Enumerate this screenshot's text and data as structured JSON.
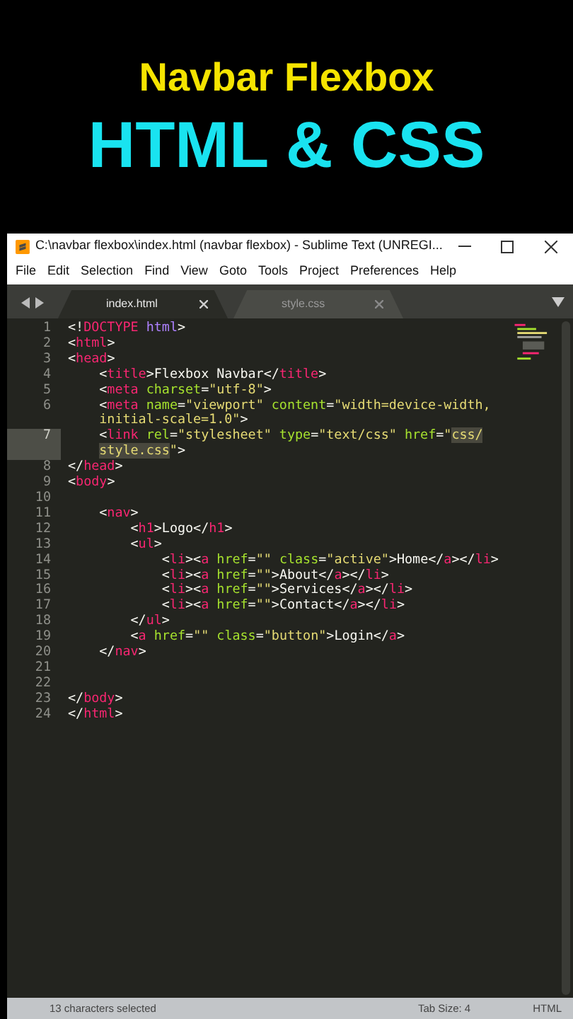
{
  "banner": {
    "title": "Navbar Flexbox",
    "subtitle": "HTML & CSS"
  },
  "window": {
    "title": "C:\\navbar flexbox\\index.html (navbar flexbox) - Sublime Text (UNREGI..."
  },
  "menu": [
    "File",
    "Edit",
    "Selection",
    "Find",
    "View",
    "Goto",
    "Tools",
    "Project",
    "Preferences",
    "Help"
  ],
  "tabs": [
    {
      "label": "index.html",
      "selected": true
    },
    {
      "label": "style.css",
      "selected": false
    }
  ],
  "code": [
    {
      "number": "1",
      "current": false,
      "segments": [
        {
          "kind": "punct",
          "text": "<!"
        },
        {
          "kind": "tag",
          "text": "DOCTYPE"
        },
        {
          "kind": "keyword",
          "text": " html"
        },
        {
          "kind": "punct",
          "text": ">"
        }
      ]
    },
    {
      "number": "2",
      "current": false,
      "segments": [
        {
          "kind": "punct",
          "text": "<"
        },
        {
          "kind": "tag",
          "text": "html"
        },
        {
          "kind": "punct",
          "text": ">"
        }
      ]
    },
    {
      "number": "3",
      "current": false,
      "segments": [
        {
          "kind": "punct",
          "text": "<"
        },
        {
          "kind": "tag",
          "text": "head"
        },
        {
          "kind": "punct",
          "text": ">"
        }
      ]
    },
    {
      "number": "4",
      "current": false,
      "segments": [
        {
          "kind": "punct",
          "text": "    <"
        },
        {
          "kind": "tag",
          "text": "title"
        },
        {
          "kind": "punct",
          "text": ">Flexbox Navbar</"
        },
        {
          "kind": "tag",
          "text": "title"
        },
        {
          "kind": "punct",
          "text": ">"
        }
      ]
    },
    {
      "number": "5",
      "current": false,
      "segments": [
        {
          "kind": "punct",
          "text": "    <"
        },
        {
          "kind": "tag",
          "text": "meta"
        },
        {
          "kind": "attr",
          "text": " charset"
        },
        {
          "kind": "punct",
          "text": "="
        },
        {
          "kind": "string",
          "text": "\"utf-8\""
        },
        {
          "kind": "punct",
          "text": ">"
        }
      ]
    },
    {
      "number": "6",
      "current": false,
      "segments": [
        {
          "kind": "punct",
          "text": "    <"
        },
        {
          "kind": "tag",
          "text": "meta"
        },
        {
          "kind": "attr",
          "text": " name"
        },
        {
          "kind": "punct",
          "text": "="
        },
        {
          "kind": "string",
          "text": "\"viewport\""
        },
        {
          "kind": "attr",
          "text": " content"
        },
        {
          "kind": "punct",
          "text": "="
        },
        {
          "kind": "string",
          "text": "\"width=device-width,"
        }
      ]
    },
    {
      "current": false,
      "segments": [
        {
          "kind": "string",
          "text": "initial-scale=1.0\""
        },
        {
          "kind": "punct",
          "text": ">"
        }
      ]
    },
    {
      "number": "7",
      "current": true,
      "segments": [
        {
          "kind": "punct",
          "text": "    <"
        },
        {
          "kind": "tag",
          "text": "link"
        },
        {
          "kind": "attr",
          "text": " rel"
        },
        {
          "kind": "punct",
          "text": "="
        },
        {
          "kind": "string",
          "text": "\"stylesheet\""
        },
        {
          "kind": "attr",
          "text": " type"
        },
        {
          "kind": "punct",
          "text": "="
        },
        {
          "kind": "string",
          "text": "\"text/css\""
        },
        {
          "kind": "attr",
          "text": " href"
        },
        {
          "kind": "punct",
          "text": "="
        },
        {
          "kind": "string",
          "text": "\""
        },
        {
          "kind": "selection",
          "text": "css/"
        }
      ]
    },
    {
      "current": true,
      "segments": [
        {
          "kind": "selection",
          "text": "style.css"
        },
        {
          "kind": "string",
          "text": "\""
        },
        {
          "kind": "punct",
          "text": ">"
        }
      ]
    },
    {
      "number": "8",
      "current": false,
      "segments": [
        {
          "kind": "punct",
          "text": "</"
        },
        {
          "kind": "tag",
          "text": "head"
        },
        {
          "kind": "punct",
          "text": ">"
        }
      ]
    },
    {
      "number": "9",
      "current": false,
      "segments": [
        {
          "kind": "punct",
          "text": "<"
        },
        {
          "kind": "tag",
          "text": "body"
        },
        {
          "kind": "punct",
          "text": ">"
        }
      ]
    },
    {
      "number": "10",
      "current": false
    },
    {
      "number": "11",
      "current": false,
      "segments": [
        {
          "kind": "punct",
          "text": "    <"
        },
        {
          "kind": "tag",
          "text": "nav"
        },
        {
          "kind": "punct",
          "text": ">"
        }
      ]
    },
    {
      "number": "12",
      "current": false,
      "segments": [
        {
          "kind": "punct",
          "text": "        <"
        },
        {
          "kind": "tag",
          "text": "h1"
        },
        {
          "kind": "punct",
          "text": ">Logo</"
        },
        {
          "kind": "tag",
          "text": "h1"
        },
        {
          "kind": "punct",
          "text": ">"
        }
      ]
    },
    {
      "number": "13",
      "current": false,
      "segments": [
        {
          "kind": "punct",
          "text": "        <"
        },
        {
          "kind": "tag",
          "text": "ul"
        },
        {
          "kind": "punct",
          "text": ">"
        }
      ]
    },
    {
      "number": "14",
      "current": false,
      "segments": [
        {
          "kind": "punct",
          "text": "            <"
        },
        {
          "kind": "tag",
          "text": "li"
        },
        {
          "kind": "punct",
          "text": "><"
        },
        {
          "kind": "tag",
          "text": "a"
        },
        {
          "kind": "attr",
          "text": " href"
        },
        {
          "kind": "punct",
          "text": "="
        },
        {
          "kind": "string",
          "text": "\"\""
        },
        {
          "kind": "attr",
          "text": " class"
        },
        {
          "kind": "punct",
          "text": "="
        },
        {
          "kind": "string",
          "text": "\"active\""
        },
        {
          "kind": "punct",
          "text": ">Home</"
        },
        {
          "kind": "tag",
          "text": "a"
        },
        {
          "kind": "punct",
          "text": "></"
        },
        {
          "kind": "tag",
          "text": "li"
        },
        {
          "kind": "punct",
          "text": ">"
        }
      ]
    },
    {
      "number": "15",
      "current": false,
      "segments": [
        {
          "kind": "punct",
          "text": "            <"
        },
        {
          "kind": "tag",
          "text": "li"
        },
        {
          "kind": "punct",
          "text": "><"
        },
        {
          "kind": "tag",
          "text": "a"
        },
        {
          "kind": "attr",
          "text": " href"
        },
        {
          "kind": "punct",
          "text": "="
        },
        {
          "kind": "string",
          "text": "\"\""
        },
        {
          "kind": "punct",
          "text": ">About</"
        },
        {
          "kind": "tag",
          "text": "a"
        },
        {
          "kind": "punct",
          "text": "></"
        },
        {
          "kind": "tag",
          "text": "li"
        },
        {
          "kind": "punct",
          "text": ">"
        }
      ]
    },
    {
      "number": "16",
      "current": false,
      "segments": [
        {
          "kind": "punct",
          "text": "            <"
        },
        {
          "kind": "tag",
          "text": "li"
        },
        {
          "kind": "punct",
          "text": "><"
        },
        {
          "kind": "tag",
          "text": "a"
        },
        {
          "kind": "attr",
          "text": " href"
        },
        {
          "kind": "punct",
          "text": "="
        },
        {
          "kind": "string",
          "text": "\"\""
        },
        {
          "kind": "punct",
          "text": ">Services</"
        },
        {
          "kind": "tag",
          "text": "a"
        },
        {
          "kind": "punct",
          "text": "></"
        },
        {
          "kind": "tag",
          "text": "li"
        },
        {
          "kind": "punct",
          "text": ">"
        }
      ]
    },
    {
      "number": "17",
      "current": false,
      "segments": [
        {
          "kind": "punct",
          "text": "            <"
        },
        {
          "kind": "tag",
          "text": "li"
        },
        {
          "kind": "punct",
          "text": "><"
        },
        {
          "kind": "tag",
          "text": "a"
        },
        {
          "kind": "attr",
          "text": " href"
        },
        {
          "kind": "punct",
          "text": "="
        },
        {
          "kind": "string",
          "text": "\"\""
        },
        {
          "kind": "punct",
          "text": ">Contact</"
        },
        {
          "kind": "tag",
          "text": "a"
        },
        {
          "kind": "punct",
          "text": "></"
        },
        {
          "kind": "tag",
          "text": "li"
        },
        {
          "kind": "punct",
          "text": ">"
        }
      ]
    },
    {
      "number": "18",
      "current": false,
      "segments": [
        {
          "kind": "punct",
          "text": "        </"
        },
        {
          "kind": "tag",
          "text": "ul"
        },
        {
          "kind": "punct",
          "text": ">"
        }
      ]
    },
    {
      "number": "19",
      "current": false,
      "segments": [
        {
          "kind": "punct",
          "text": "        <"
        },
        {
          "kind": "tag",
          "text": "a"
        },
        {
          "kind": "attr",
          "text": " href"
        },
        {
          "kind": "punct",
          "text": "="
        },
        {
          "kind": "string",
          "text": "\"\""
        },
        {
          "kind": "attr",
          "text": " class"
        },
        {
          "kind": "punct",
          "text": "="
        },
        {
          "kind": "string",
          "text": "\"button\""
        },
        {
          "kind": "punct",
          "text": ">Login</"
        },
        {
          "kind": "tag",
          "text": "a"
        },
        {
          "kind": "punct",
          "text": ">"
        }
      ]
    },
    {
      "number": "20",
      "current": false,
      "segments": [
        {
          "kind": "punct",
          "text": "    </"
        },
        {
          "kind": "tag",
          "text": "nav"
        },
        {
          "kind": "punct",
          "text": ">"
        }
      ]
    },
    {
      "number": "21",
      "current": false
    },
    {
      "number": "22",
      "current": false
    },
    {
      "number": "23",
      "current": false,
      "segments": [
        {
          "kind": "punct",
          "text": "</"
        },
        {
          "kind": "tag",
          "text": "body"
        },
        {
          "kind": "punct",
          "text": ">"
        }
      ]
    },
    {
      "number": "24",
      "current": false,
      "segments": [
        {
          "kind": "punct",
          "text": "</"
        },
        {
          "kind": "tag",
          "text": "html"
        },
        {
          "kind": "punct",
          "text": ">"
        }
      ]
    }
  ],
  "status_bar": {
    "selection": "13 characters selected",
    "tab_size": "Tab Size: 4",
    "syntax": "HTML"
  }
}
